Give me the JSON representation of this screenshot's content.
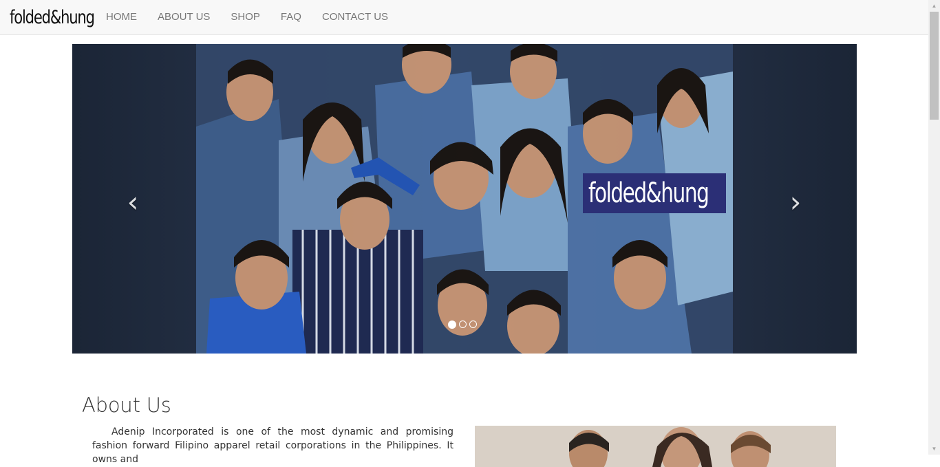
{
  "brand": "folded&hung",
  "nav": {
    "items": [
      "HOME",
      "ABOUT US",
      "SHOP",
      "FAQ",
      "CONTACT US"
    ]
  },
  "carousel": {
    "overlay_logo": "folded&hung",
    "prev_glyph": "‹",
    "next_glyph": "›",
    "slide_count": 3,
    "active_slide": 1
  },
  "about": {
    "title": "About Us",
    "text": "Adenip Incorporated is one of the most dynamic and promising fashion forward Filipino apparel retail corporations in the Philippines. It owns and"
  },
  "colors": {
    "navbar_bg": "#f8f8f8",
    "nav_text": "#777777",
    "carousel_bg": "#1d2a3e",
    "banner_bg": "#2b2f76"
  }
}
